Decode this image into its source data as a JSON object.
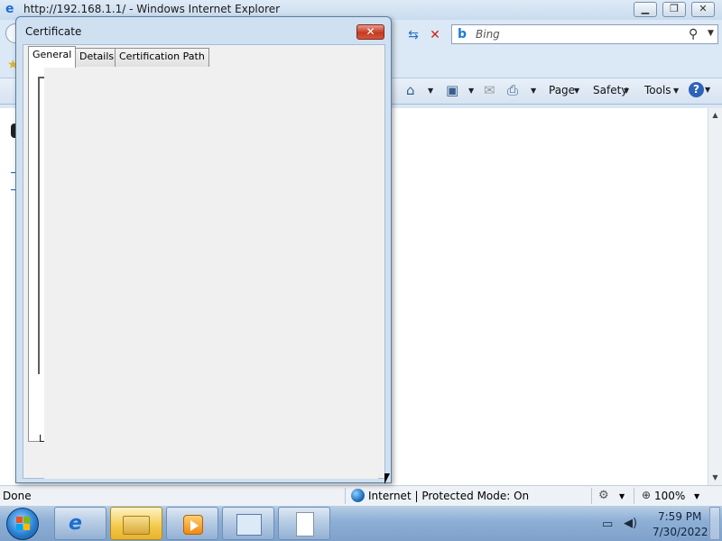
{
  "browser": {
    "title": "http://192.168.1.1/ - Windows Internet Explorer",
    "search_placeholder": "Bing",
    "command_bar": {
      "page": "Page",
      "safety": "Safety",
      "tools": "Tools",
      "help": "?"
    },
    "status": {
      "text": "Done",
      "zone": "Internet | Protected Mode: On",
      "zoom": "100%"
    }
  },
  "dialog": {
    "title": "Certificate",
    "tabs": [
      {
        "label": "General",
        "active": true
      },
      {
        "label": "Details",
        "active": false
      },
      {
        "label": "Certification Path",
        "active": false
      }
    ],
    "learn_fragment": "Le"
  },
  "taskbar": {
    "items": [
      "internet-explorer",
      "windows-explorer",
      "media-player",
      "control-panel",
      "document"
    ],
    "active_item": "windows-explorer"
  },
  "tray": {
    "time": "7:59 PM",
    "date": "7/30/2022"
  },
  "colors": {
    "dialog_close": "#c33a23",
    "taskbar": "#8fb0d6",
    "window_frame": "#cfe0f1"
  }
}
